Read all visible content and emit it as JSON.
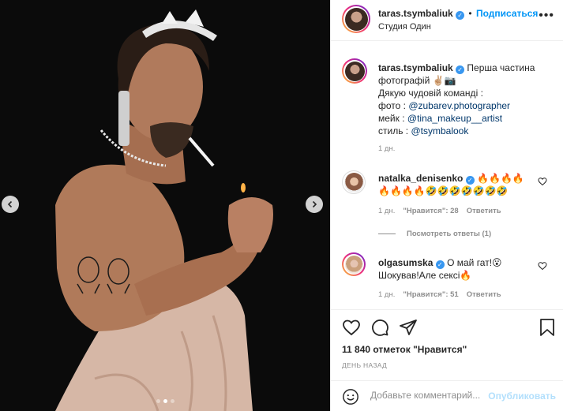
{
  "photo": {
    "prev_label": "‹",
    "next_label": "›",
    "slides": 3,
    "active_slide": 2
  },
  "header": {
    "username": "taras.tsymbaliuk",
    "verified_mark": "✓",
    "separator": "•",
    "follow_label": "Подписаться",
    "location": "Студия Один",
    "more_label": "•••"
  },
  "caption": {
    "username": "taras.tsymbaliuk",
    "line1": "Перша частина",
    "line2": "фотографій ✌🏼📷",
    "line3": "Дякую чудовій команді :",
    "line4_prefix": "фото : ",
    "line4_link": "@zubarev.photographer",
    "line5_prefix": "мейк : ",
    "line5_link": "@tina_makeup__artist",
    "line6_prefix": "стиль : ",
    "line6_link": "@tsymbalook",
    "time": "1 дн."
  },
  "comments": [
    {
      "username": "natalka_denisenko",
      "text_line1": "🔥🔥🔥🔥",
      "text_line2": "🔥🔥🔥🔥🤣🤣🤣🤣🤣🤣🤣",
      "time": "1 дн.",
      "likes": "\"Нравится\": 28",
      "reply": "Ответить"
    },
    {
      "username": "olgasumska",
      "text_line1": "О май гат!😮",
      "text_line2": "Шокував!Але сексі🔥",
      "time": "1 дн.",
      "likes": "\"Нравится\": 51",
      "reply": "Ответить"
    }
  ],
  "view_replies": "Посмотреть ответы (1)",
  "likes_text": "11 840 отметок \"Нравится\"",
  "date_text": "ДЕНЬ НАЗАД",
  "comment_box": {
    "placeholder": "Добавьте комментарий...",
    "publish_label": "Опубликовать"
  },
  "colors": {
    "accent": "#0095f6",
    "verified": "#3897f0",
    "publish_disabled": "#b2dffc",
    "muted": "#8e8e8e"
  },
  "icons": [
    "heart-icon",
    "comment-icon",
    "share-icon",
    "bookmark-icon",
    "emoji-icon",
    "more-icon",
    "chevron-left-icon",
    "chevron-right-icon"
  ]
}
